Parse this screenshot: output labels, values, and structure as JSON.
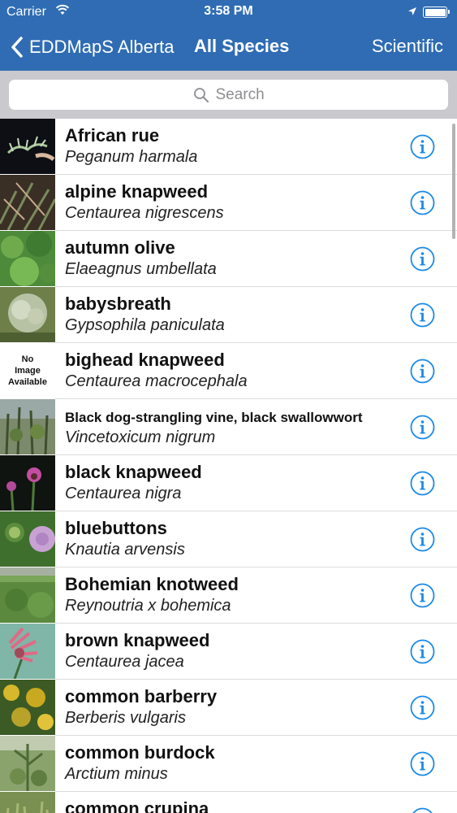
{
  "status_bar": {
    "carrier": "Carrier",
    "time": "3:58 PM"
  },
  "nav": {
    "back_label": "EDDMapS Alberta",
    "title": "All Species",
    "right_button": "Scientific"
  },
  "search": {
    "placeholder": "Search"
  },
  "colors": {
    "nav_background": "#2f6cb4",
    "info_icon": "#1a8ae6",
    "search_bar_background": "#c9c9ce"
  },
  "species": [
    {
      "common": "African rue",
      "scientific": "Peganum harmala",
      "thumb": "plant-sketch"
    },
    {
      "common": "alpine knapweed",
      "scientific": "Centaurea nigrescens",
      "thumb": "dark-foliage"
    },
    {
      "common": "autumn olive",
      "scientific": "Elaeagnus umbellata",
      "thumb": "green-foliage"
    },
    {
      "common": "babysbreath",
      "scientific": "Gypsophila paniculata",
      "thumb": "pale-shrub"
    },
    {
      "common": "bighead knapweed",
      "scientific": "Centaurea macrocephala",
      "thumb": "no-image"
    },
    {
      "common": "Black dog-strangling vine, black swallowwort",
      "scientific": "Vincetoxicum nigrum",
      "thumb": "vine-field"
    },
    {
      "common": "black knapweed",
      "scientific": "Centaurea nigra",
      "thumb": "purple-flower-dark"
    },
    {
      "common": "bluebuttons",
      "scientific": "Knautia arvensis",
      "thumb": "pink-flower"
    },
    {
      "common": "Bohemian knotweed",
      "scientific": "Reynoutria x bohemica",
      "thumb": "green-field"
    },
    {
      "common": "brown knapweed",
      "scientific": "Centaurea jacea",
      "thumb": "pink-flower-teal"
    },
    {
      "common": "common barberry",
      "scientific": "Berberis vulgaris",
      "thumb": "yellow-shrub"
    },
    {
      "common": "common burdock",
      "scientific": "Arctium minus",
      "thumb": "burdock"
    },
    {
      "common": "common crupina",
      "scientific": "",
      "thumb": "grass"
    }
  ],
  "no_image_text": [
    "No",
    "Image",
    "Available"
  ]
}
